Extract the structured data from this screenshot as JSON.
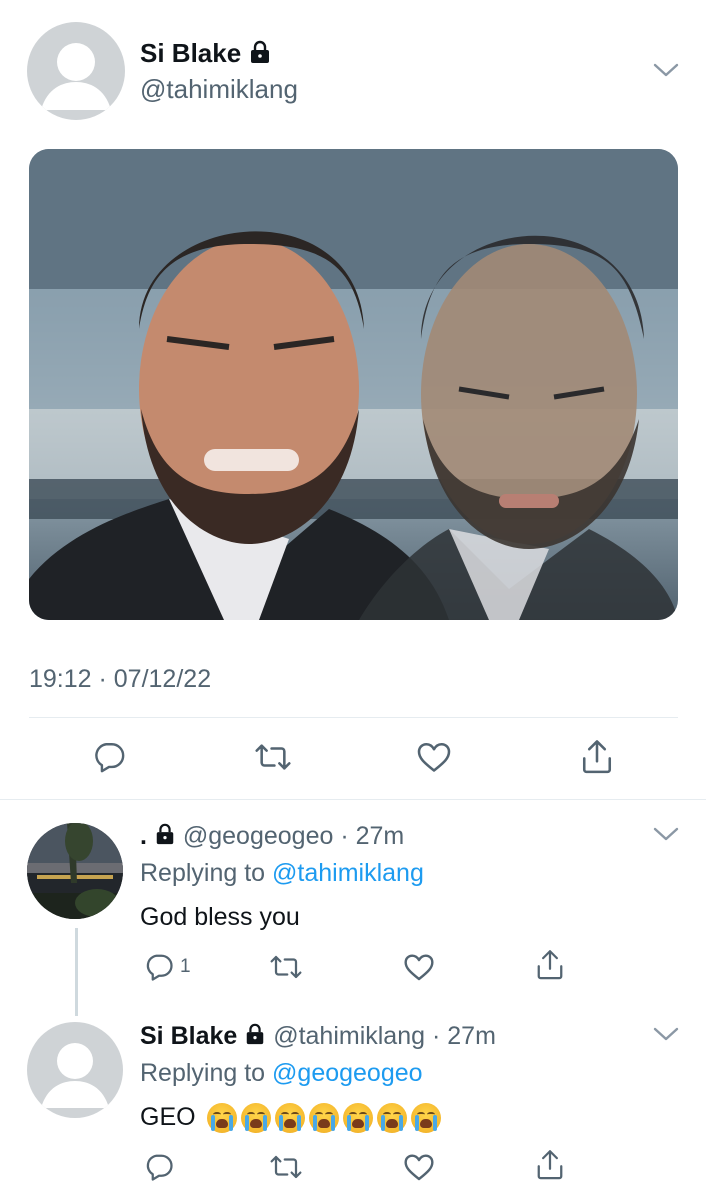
{
  "main_tweet": {
    "display_name": "Si Blake",
    "handle": "@tahimiklang",
    "timestamp": "19:12 · 07/12/22",
    "actions": {
      "reply_icon": "reply-icon",
      "retweet_icon": "retweet-icon",
      "like_icon": "heart-icon",
      "share_icon": "share-icon"
    }
  },
  "reply1": {
    "display_name": ".",
    "handle": "@geogeogeo",
    "separator": "·",
    "time": "27m",
    "replying_prefix": "Replying to",
    "replying_to": "@tahimiklang",
    "text": "God bless you",
    "reply_count": "1"
  },
  "reply2": {
    "display_name": "Si Blake",
    "handle": "@tahimiklang",
    "separator": "·",
    "time": "27m",
    "replying_prefix": "Replying to",
    "replying_to": "@geogeogeo",
    "text": "GEO",
    "emoji_count": 7,
    "emoji_name": "loudly-crying-face"
  },
  "colors": {
    "text": "#0f1419",
    "muted": "#536471",
    "link": "#1d9bf0",
    "divider": "#e6ecf0"
  }
}
